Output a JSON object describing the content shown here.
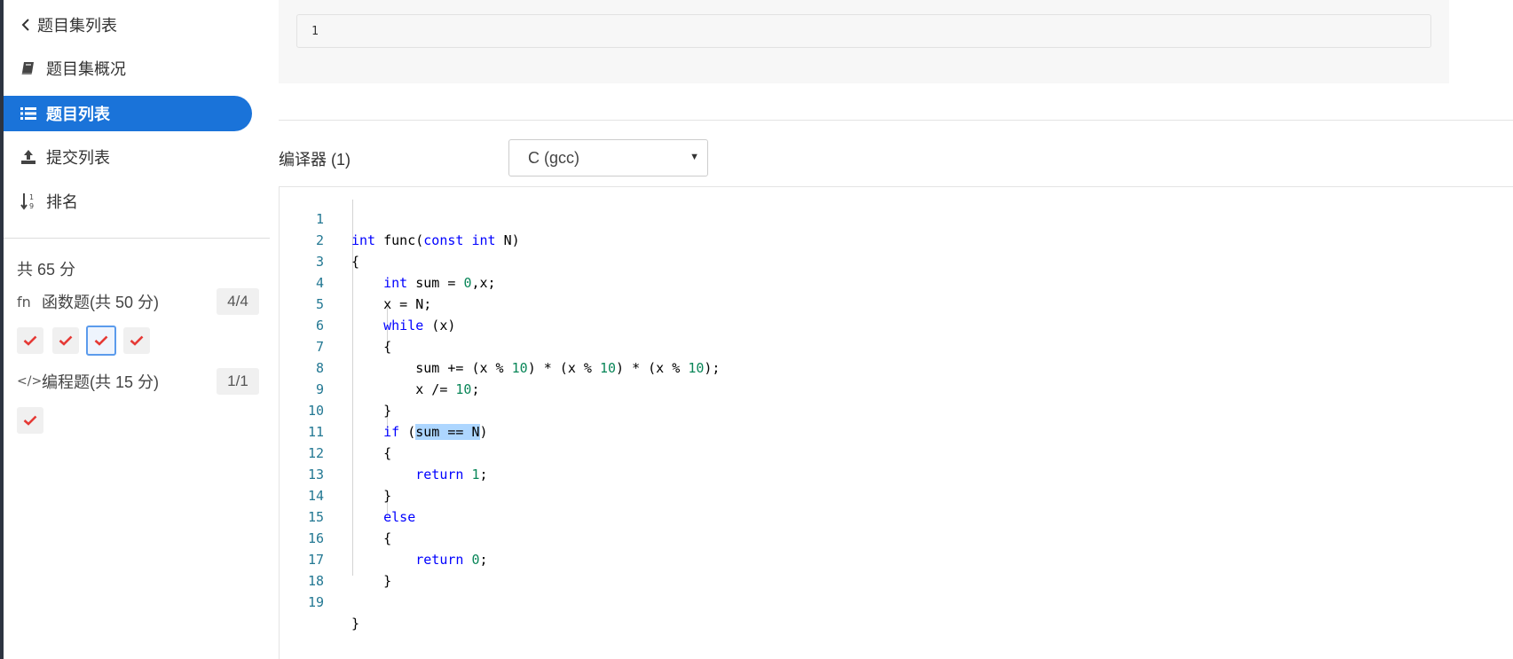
{
  "sidebar": {
    "back_label": "题目集列表",
    "items": [
      {
        "label": "题目集概况",
        "icon": "book-icon"
      },
      {
        "label": "题目列表",
        "icon": "list-icon",
        "active": true
      },
      {
        "label": "提交列表",
        "icon": "upload-icon"
      },
      {
        "label": "排名",
        "icon": "sort-numeric-icon"
      }
    ],
    "total": "共 65 分",
    "groups": [
      {
        "label": "函数题(共 50 分)",
        "icon_text": "fn",
        "badge": "4/4",
        "checks": 4
      },
      {
        "label": "编程题(共 15 分)",
        "icon_text": "</>",
        "badge": "1/1",
        "checks": 1
      }
    ]
  },
  "output": {
    "value": "1"
  },
  "compiler": {
    "label": "编译器 (1)",
    "selected": "C (gcc)"
  },
  "editor": {
    "line_numbers": [
      "1",
      "2",
      "3",
      "4",
      "5",
      "6",
      "7",
      "8",
      "9",
      "10",
      "11",
      "12",
      "13",
      "14",
      "15",
      "16",
      "17",
      "18",
      "19"
    ],
    "code": [
      "int func(const int N)",
      "{",
      "    int sum = 0,x;",
      "    x = N;",
      "    while (x)",
      "    {",
      "        sum += (x % 10) * (x % 10) * (x % 10);",
      "        x /= 10;",
      "    }",
      "    if (sum == N)",
      "    {",
      "        return 1;",
      "    }",
      "    else",
      "    {",
      "        return 0;",
      "    }",
      "",
      "}"
    ],
    "selection": "sum == N"
  },
  "colors": {
    "accent": "#1a73d9",
    "check": "#e53935",
    "keyword": "#0000ff",
    "number": "#098658",
    "line_number": "#237893"
  }
}
